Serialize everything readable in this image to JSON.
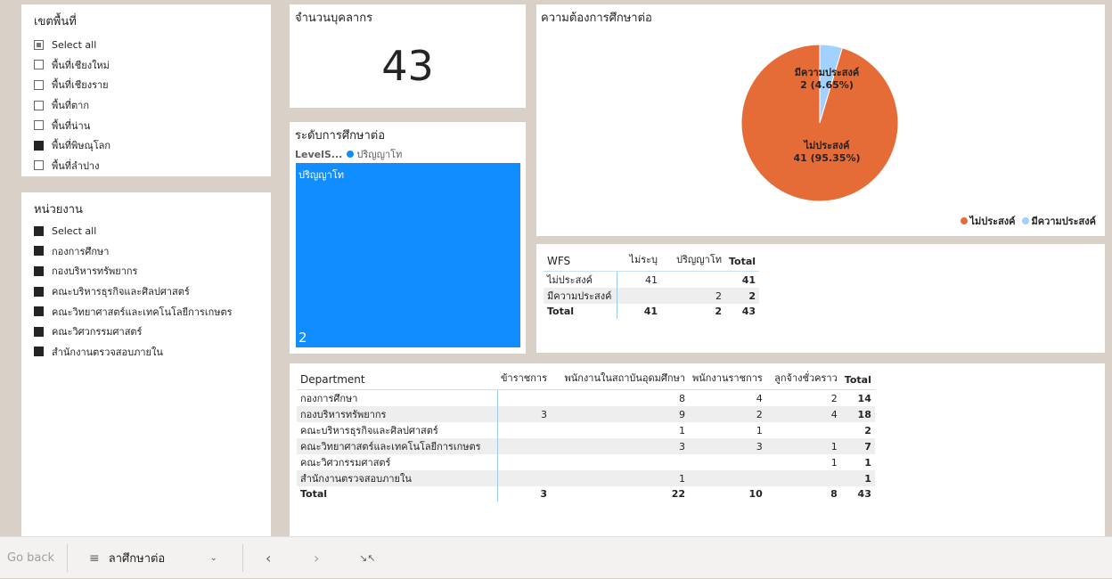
{
  "area_slicer": {
    "title": "เขตพื้นที่",
    "items": [
      {
        "label": "Select all",
        "state": "partial"
      },
      {
        "label": "พื้นที่เชียงใหม่",
        "state": "empty"
      },
      {
        "label": "พื้นที่เชียงราย",
        "state": "empty"
      },
      {
        "label": "พื้นที่ตาก",
        "state": "empty"
      },
      {
        "label": "พื้นที่น่าน",
        "state": "empty"
      },
      {
        "label": "พื้นที่พิษณุโลก",
        "state": "filled"
      },
      {
        "label": "พื้นที่ลำปาง",
        "state": "empty"
      }
    ]
  },
  "unit_slicer": {
    "title": "หน่วยงาน",
    "items": [
      {
        "label": "Select all",
        "state": "filled"
      },
      {
        "label": "กองการศึกษา",
        "state": "filled"
      },
      {
        "label": "กองบริหารทรัพยากร",
        "state": "filled"
      },
      {
        "label": "คณะบริหารธุรกิจและศิลปศาสตร์",
        "state": "filled"
      },
      {
        "label": "คณะวิทยาศาสตร์และเทคโนโลยีการเกษตร",
        "state": "filled"
      },
      {
        "label": "คณะวิศวกรรมศาสตร์",
        "state": "filled"
      },
      {
        "label": "สำนักงานตรวจสอบภายใน",
        "state": "filled"
      }
    ]
  },
  "personnel_card": {
    "title": "จำนวนบุคลากร",
    "value": "43"
  },
  "level_chart": {
    "title": "ระดับการศึกษาต่อ",
    "legend_field": "LevelS...",
    "legend_item": "ปริญญาโท",
    "tile_label": "ปริญญาโท",
    "tile_value": "2",
    "color": "#118dff"
  },
  "chart_data": {
    "type": "pie",
    "title": "ความต้องการศึกษาต่อ",
    "slices": [
      {
        "name": "ไม่ประสงค์",
        "value": 41,
        "percent": "95.35%",
        "color": "#e66c37"
      },
      {
        "name": "มีความประสงค์",
        "value": 2,
        "percent": "4.65%",
        "color": "#a0d1ff"
      }
    ],
    "labels": [
      {
        "line1": "มีความประสงค์",
        "line2": "2 (4.65%)"
      },
      {
        "line1": "ไม่ประสงค์",
        "line2": "41 (95.35%)"
      }
    ],
    "legend": [
      "ไม่ประสงค์",
      "มีความประสงค์"
    ],
    "legend_position": "bottom-right"
  },
  "wfs_table": {
    "headers": [
      "WFS",
      "ไม่ระบุ",
      "ปริญญาโท",
      "Total"
    ],
    "rows": [
      [
        "ไม่ประสงค์",
        "41",
        "",
        "41"
      ],
      [
        "มีความประสงค์",
        "",
        "2",
        "2"
      ]
    ],
    "total": [
      "Total",
      "41",
      "2",
      "43"
    ]
  },
  "dept_table": {
    "headers": [
      "Department",
      "ข้าราชการ",
      "พนักงานในสถาบันอุดมศึกษา",
      "พนักงานราชการ",
      "ลูกจ้างชั่วคราว",
      "Total"
    ],
    "rows": [
      [
        "กองการศึกษา",
        "",
        "8",
        "4",
        "2",
        "14"
      ],
      [
        "กองบริหารทรัพยากร",
        "3",
        "9",
        "2",
        "4",
        "18"
      ],
      [
        "คณะบริหารธุรกิจและศิลปศาสตร์",
        "",
        "1",
        "1",
        "",
        "2"
      ],
      [
        "คณะวิทยาศาสตร์และเทคโนโลยีการเกษตร",
        "",
        "3",
        "3",
        "1",
        "7"
      ],
      [
        "คณะวิศวกรรมศาสตร์",
        "",
        "",
        "",
        "1",
        "1"
      ],
      [
        "สำนักงานตรวจสอบภายใน",
        "",
        "1",
        "",
        "",
        "1"
      ]
    ],
    "total": [
      "Total",
      "3",
      "22",
      "10",
      "8",
      "43"
    ]
  },
  "bottom_bar": {
    "go_back": "Go back",
    "page_label": "ลาศึกษาต่อ"
  }
}
